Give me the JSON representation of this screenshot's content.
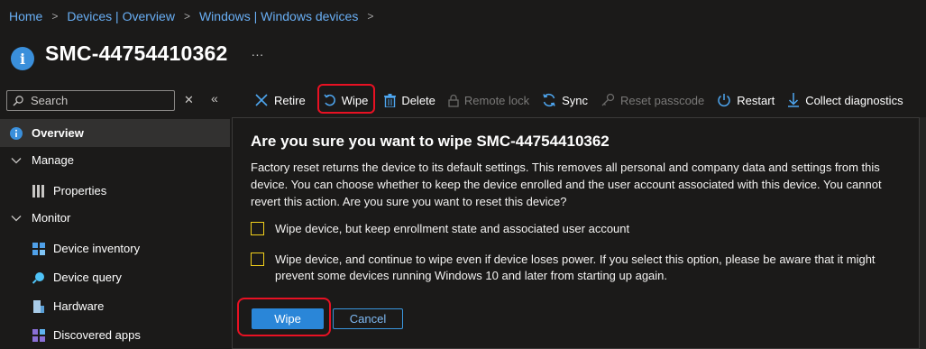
{
  "breadcrumb": {
    "items": [
      "Home",
      "Devices | Overview",
      "Windows | Windows devices"
    ],
    "separator": ">"
  },
  "header": {
    "title": "SMC-44754410362",
    "more": "···"
  },
  "search": {
    "placeholder": "Search"
  },
  "sidebar": {
    "items": [
      {
        "label": "Overview",
        "icon": "info-icon"
      },
      {
        "label": "Manage",
        "icon": "chevron-down-icon"
      },
      {
        "label": "Properties",
        "icon": "properties-icon"
      },
      {
        "label": "Monitor",
        "icon": "chevron-down-icon"
      },
      {
        "label": "Device inventory",
        "icon": "inventory-icon"
      },
      {
        "label": "Device query",
        "icon": "query-icon"
      },
      {
        "label": "Hardware",
        "icon": "hardware-icon"
      },
      {
        "label": "Discovered apps",
        "icon": "apps-icon"
      }
    ]
  },
  "toolbar": {
    "retire": "Retire",
    "wipe": "Wipe",
    "delete": "Delete",
    "remote_lock": "Remote lock",
    "sync": "Sync",
    "reset_passcode": "Reset passcode",
    "restart": "Restart",
    "collect_diagnostics": "Collect diagnostics"
  },
  "dialog": {
    "title": "Are you sure you want to wipe SMC-44754410362",
    "body": "Factory reset returns the device to its default settings. This removes all personal and company data and settings from this device. You can choose whether to keep the device enrolled and the user account associated with this device. You cannot revert this action. Are you sure you want to reset this device?",
    "option1": "Wipe device, but keep enrollment state and associated user account",
    "option2": "Wipe device, and continue to wipe even if device loses power. If you select this option, please be aware that it might prevent some devices running Windows 10 and later from starting up again.",
    "confirm": "Wipe",
    "cancel": "Cancel"
  },
  "colors": {
    "accent": "#2a86d8",
    "highlight": "#e81123",
    "checkbox_border": "#f2d01b",
    "link": "#69aff5"
  }
}
